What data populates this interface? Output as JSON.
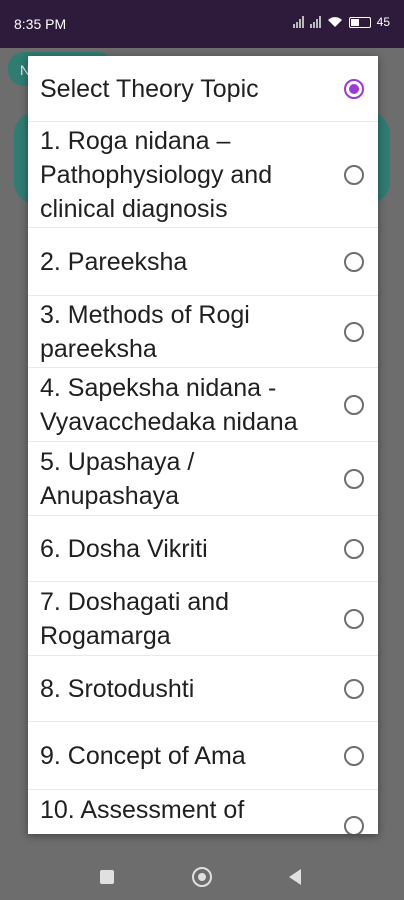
{
  "status": {
    "time": "8:35 PM",
    "battery": "45"
  },
  "background": {
    "chip_label": "N"
  },
  "dialog": {
    "items": [
      {
        "label": "Select Theory Topic",
        "selected": true
      },
      {
        "label": "1. Roga nidana – Pathophysiology and clinical diagnosis",
        "selected": false
      },
      {
        "label": "2. Pareeksha",
        "selected": false
      },
      {
        "label": "3. Methods of Rogi pareeksha",
        "selected": false
      },
      {
        "label": "4. Sapeksha nidana - Vyavacchedaka nidana",
        "selected": false
      },
      {
        "label": "5. Upashaya / Anupashaya",
        "selected": false
      },
      {
        "label": "6. Dosha Vikriti",
        "selected": false
      },
      {
        "label": "7. Doshagati and Rogamarga",
        "selected": false
      },
      {
        "label": "8. Srotodushti",
        "selected": false
      },
      {
        "label": "9. Concept of Ama",
        "selected": false
      },
      {
        "label": "10. Assessment of",
        "selected": false
      }
    ]
  },
  "colors": {
    "accent": "#9b3ad6",
    "status_bar": "#2e1a3a",
    "teal": "#2f7c72"
  }
}
